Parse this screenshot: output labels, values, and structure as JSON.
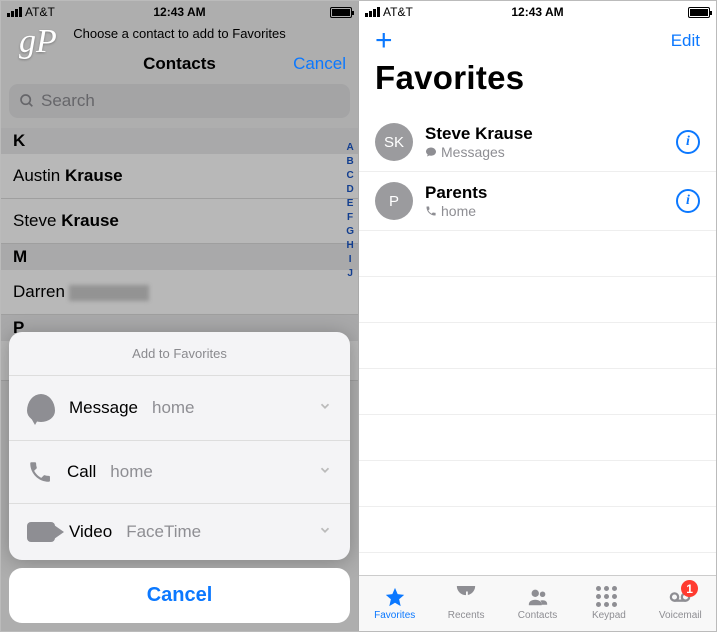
{
  "status": {
    "carrier": "AT&T",
    "time": "12:43 AM"
  },
  "left": {
    "watermark": "gP",
    "choose_line": "Choose a contact to add to Favorites",
    "title": "Contacts",
    "cancel": "Cancel",
    "search_placeholder": "Search",
    "sections": {
      "k": "K",
      "k_rows": [
        {
          "first": "Austin",
          "last": "Krause"
        },
        {
          "first": "Steve",
          "last": "Krause"
        }
      ],
      "m": "M",
      "m_rows": [
        {
          "first": "Darren",
          "redacted": true
        }
      ],
      "p": "P"
    },
    "index_letters": [
      "A",
      "B",
      "C",
      "D",
      "E",
      "F",
      "G",
      "H",
      "I",
      "J"
    ],
    "sheet": {
      "title": "Add to Favorites",
      "rows": [
        {
          "icon": "message",
          "label": "Message",
          "sub": "home"
        },
        {
          "icon": "call",
          "label": "Call",
          "sub": "home"
        },
        {
          "icon": "video",
          "label": "Video",
          "sub": "FaceTime"
        }
      ],
      "cancel": "Cancel"
    }
  },
  "right": {
    "edit": "Edit",
    "title": "Favorites",
    "favorites": [
      {
        "initials": "SK",
        "name": "Steve Krause",
        "sub": "Messages",
        "sub_icon": "bubble"
      },
      {
        "initials": "P",
        "name": "Parents",
        "sub": "home",
        "sub_icon": "phone"
      }
    ],
    "tabs": {
      "favorites": "Favorites",
      "recents": "Recents",
      "contacts": "Contacts",
      "keypad": "Keypad",
      "voicemail": "Voicemail",
      "voicemail_badge": "1"
    }
  }
}
